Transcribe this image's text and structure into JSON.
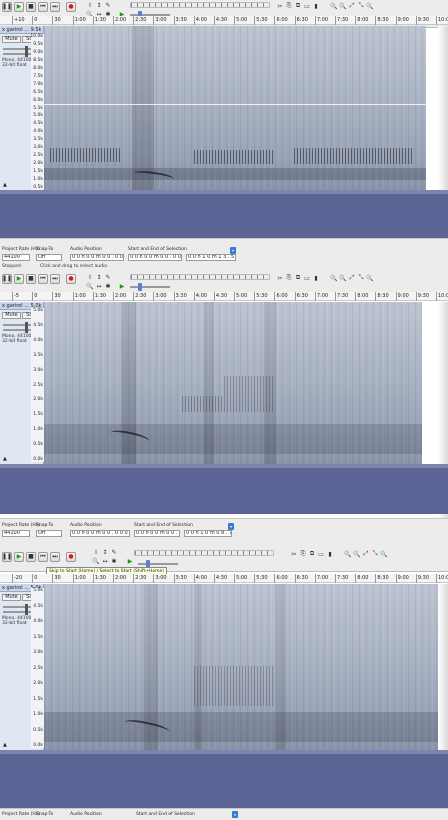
{
  "transport": {
    "pause": "❚❚",
    "play": "▶",
    "stop": "■",
    "skip_start": "⏮",
    "skip_end": "⏭",
    "record": "●"
  },
  "tools": {
    "selection": "I",
    "envelope": "↕",
    "draw": "✎",
    "zoom": "🔍",
    "timeshift": "↔",
    "multi": "✱"
  },
  "edit_icons": [
    "✂",
    "⎘",
    "⧉",
    "▭",
    "▮"
  ],
  "zoom_icons": [
    "🔍",
    "🔍",
    "⤢",
    "⤡",
    "🔍"
  ],
  "panels": [
    {
      "ruler": [
        "+10",
        "0",
        "30",
        "1:00",
        "1:30",
        "2:00",
        "2:30",
        "3:00",
        "3:30",
        "4:00",
        "4:30",
        "5:00",
        "5:30",
        "6:00",
        "6:30",
        "7:00",
        "7:30",
        "8:00",
        "8:30",
        "9:00",
        "9:30",
        "10:00"
      ],
      "track": {
        "name": "x garirol ... 9.5k",
        "mute": "Mute",
        "solo": "Solo",
        "format": "Mono, 44100Hz 32-bit float"
      },
      "yaxis": [
        "10.0k",
        "9.5k",
        "9.0k",
        "8.5k",
        "8.0k",
        "7.5k",
        "7.0k",
        "6.5k",
        "6.0k",
        "5.5k",
        "5.0k",
        "4.5k",
        "4.0k",
        "3.5k",
        "3.0k",
        "2.5k",
        "2.0k",
        "1.5k",
        "1.0k",
        "0.5k"
      ],
      "status": {
        "rate_label": "Project Rate (Hz)",
        "rate": "44100",
        "snap_label": "Snap-To",
        "snap": "Off",
        "pos_label": "Audio Position",
        "pos": "0 0 h 0 0 m 0 0 . 0 0 0 s",
        "sel_label": "Start and End of Selection",
        "sel_start": "0 0 h 0 0 m 0 0 . 0 0 0 s",
        "sel_end": "0 0 h 1 0 m 1 3 . 5 5 2 s",
        "state": "Stopped.",
        "hint": "Click and drag to select audio"
      }
    },
    {
      "ruler": [
        "-5",
        "0",
        "30",
        "1:00",
        "1:30",
        "2:00",
        "2:30",
        "3:00",
        "3:30",
        "4:00",
        "4:30",
        "5:00",
        "5:30",
        "6:00",
        "6:30",
        "7:00",
        "7:30",
        "8:00",
        "8:30",
        "9:00",
        "9:30",
        "10:00"
      ],
      "track": {
        "name": "x garirol ... 5.0k",
        "mute": "Mute",
        "solo": "Solo",
        "format": "Mono, 44100Hz 32-bit float"
      },
      "yaxis": [
        "5.0k",
        "4.5k",
        "4.0k",
        "3.5k",
        "3.0k",
        "2.5k",
        "2.0k",
        "1.5k",
        "1.0k",
        "0.5k",
        "0.0k"
      ],
      "status": {
        "rate_label": "Project Rate (Hz)",
        "rate": "44100",
        "snap_label": "Snap-To",
        "snap": "Off",
        "pos_label": "Audio Position",
        "pos": "0 0 h 0 0 m 0 0 . 0 0 0 s",
        "sel_label": "Start and End of Selection",
        "sel_start": "0 0 h 0 0 m 0 0 . 0 0 0 s",
        "sel_end": "0 0 h 1 0 m 0 8 . 7 5 5 s",
        "state": "",
        "hint": ""
      }
    },
    {
      "ruler": [
        "-20",
        "0",
        "30",
        "1:00",
        "1:30",
        "2:00",
        "2:30",
        "3:00",
        "3:30",
        "4:00",
        "4:30",
        "5:00",
        "5:30",
        "6:00",
        "6:30",
        "7:00",
        "7:30",
        "8:00",
        "8:30",
        "9:00",
        "9:30",
        "10:00"
      ],
      "track": {
        "name": "x garirol ... 5.0k",
        "mute": "Mute",
        "solo": "Solo",
        "format": "Mono, 44100Hz 32-bit float"
      },
      "yaxis": [
        "5.0k",
        "4.5k",
        "4.0k",
        "3.5k",
        "3.0k",
        "2.5k",
        "2.0k",
        "1.5k",
        "1.0k",
        "0.5k",
        "0.0k"
      ],
      "tooltip": "Skip to Start (Home) / Select to Start (Shift+Home)",
      "status": {
        "rate_label": "Project Rate (Hz)",
        "rate": "",
        "snap_label": "Snap-To",
        "snap": "",
        "pos_label": "Audio Position",
        "pos": "",
        "sel_label": "Start and End of Selection",
        "sel_start": "",
        "sel_end": "",
        "state": "",
        "hint": ""
      }
    }
  ]
}
